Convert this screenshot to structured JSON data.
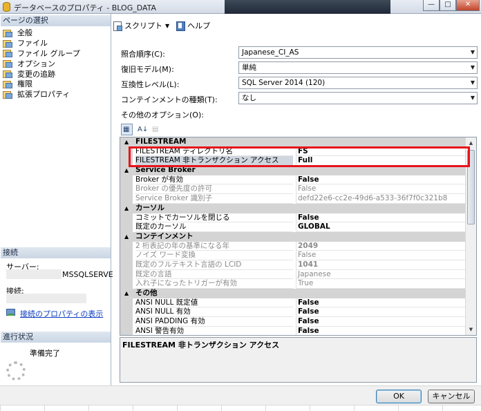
{
  "window": {
    "title": "データベースのプロパティ - BLOG_DATA",
    "min_glyph": "—",
    "max_glyph": "□",
    "close_glyph": "✕"
  },
  "left_pane": {
    "pages_header": "ページの選択",
    "pages": [
      {
        "label": "全般",
        "icon": "page-icon"
      },
      {
        "label": "ファイル",
        "icon": "page-icon"
      },
      {
        "label": "ファイル グループ",
        "icon": "page-icon"
      },
      {
        "label": "オプション",
        "icon": "page-icon"
      },
      {
        "label": "変更の追跡",
        "icon": "page-icon"
      },
      {
        "label": "権限",
        "icon": "page-icon"
      },
      {
        "label": "拡張プロパティ",
        "icon": "page-icon"
      }
    ],
    "connection_header": "接続",
    "server_label": "サーバー:",
    "server_value": "MSSQLSERVE",
    "connection_label": "接続:",
    "view_connection_link": "接続のプロパティの表示",
    "progress_header": "進行状況",
    "progress_status": "準備完了"
  },
  "toolbar": {
    "script_label": "スクリプト",
    "script_dropdown_glyph": "▼",
    "help_label": "ヘルプ"
  },
  "form": {
    "collation_label": "照合順序(C):",
    "collation_value": "Japanese_CI_AS",
    "recovery_label": "復旧モデル(M):",
    "recovery_value": "単純",
    "compat_label": "互換性レベル(L):",
    "compat_value": "SQL Server 2014 (120)",
    "containment_label": "コンテインメントの種類(T):",
    "containment_value": "なし",
    "other_options_label": "その他のオプション(O):",
    "combo_arrow": "▼"
  },
  "property_grid": {
    "toolbar_glyphs": {
      "categorized": "▦",
      "alphabetical": "A↓",
      "pages": "▤"
    },
    "rows": [
      {
        "type": "category",
        "name": "FILESTREAM",
        "toggle": "▲"
      },
      {
        "type": "property",
        "name": "FILESTREAM ディレクトリ名",
        "value": "FS",
        "readonly": false
      },
      {
        "type": "property",
        "name": "FILESTREAM 非トランザクション アクセス",
        "value": "Full",
        "readonly": false,
        "selected": true
      },
      {
        "type": "category",
        "name": "Service Broker",
        "toggle": "▲"
      },
      {
        "type": "property",
        "name": "Broker が有効",
        "value": "False",
        "readonly": false
      },
      {
        "type": "property",
        "name": "Broker の優先度の許可",
        "value": "False",
        "readonly": true
      },
      {
        "type": "property",
        "name": "Service Broker 識別子",
        "value": "defd22e6-cc2e-49d6-a533-36f7f0c321b8",
        "readonly": true
      },
      {
        "type": "category",
        "name": "カーソル",
        "toggle": "▲"
      },
      {
        "type": "property",
        "name": "コミットでカーソルを閉じる",
        "value": "False",
        "readonly": false
      },
      {
        "type": "property",
        "name": "既定のカーソル",
        "value": "GLOBAL",
        "readonly": false
      },
      {
        "type": "category",
        "name": "コンテインメント",
        "toggle": "▲"
      },
      {
        "type": "property",
        "name": "2 桁表記の年の基準になる年",
        "value": "2049",
        "readonly": true,
        "boldval": true
      },
      {
        "type": "property",
        "name": "ノイズ ワード変換",
        "value": "False",
        "readonly": true
      },
      {
        "type": "property",
        "name": "既定のフルテキスト言語の LCID",
        "value": "1041",
        "readonly": true,
        "boldval": true
      },
      {
        "type": "property",
        "name": "既定の言語",
        "value": "Japanese",
        "readonly": true
      },
      {
        "type": "property",
        "name": "入れ子になったトリガーが有効",
        "value": "True",
        "readonly": true
      },
      {
        "type": "category",
        "name": "その他",
        "toggle": "▲"
      },
      {
        "type": "property",
        "name": "ANSI NULL 既定値",
        "value": "False",
        "readonly": false
      },
      {
        "type": "property",
        "name": "ANSI NULL 有効",
        "value": "False",
        "readonly": false
      },
      {
        "type": "property",
        "name": "ANSI PADDING 有効",
        "value": "False",
        "readonly": false
      },
      {
        "type": "property",
        "name": "ANSI 警告有効",
        "value": "False",
        "readonly": false
      }
    ],
    "scroll_up": "▲",
    "scroll_down": "▼"
  },
  "description": {
    "title": "FILESTREAM 非トランザクション アクセス"
  },
  "buttons": {
    "ok": "OK",
    "cancel": "キャンセル"
  },
  "colors": {
    "highlight_border": "#e8131b",
    "link": "#0b3cc0",
    "category_bg": "#d4d4d4"
  }
}
